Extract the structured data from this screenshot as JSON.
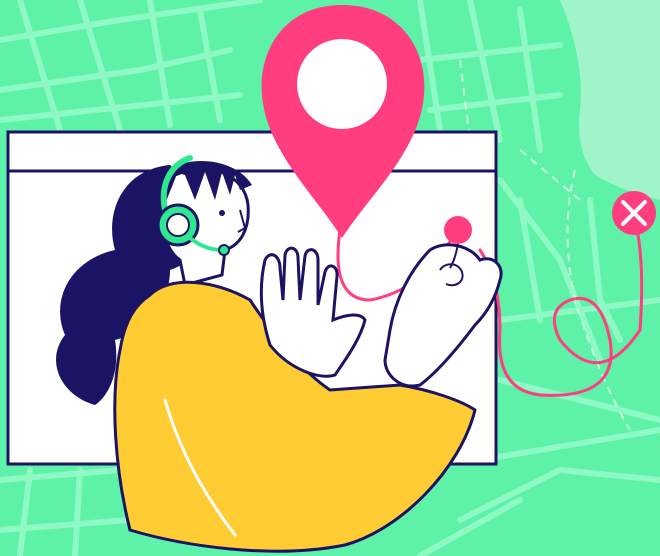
{
  "colors": {
    "map_background": "#5ef2a8",
    "map_roads": "#8ff9c6",
    "map_park": "#9ff5c9",
    "outline": "#1b1464",
    "window_fill": "#ffffff",
    "pin": "#ff3d7f",
    "sweater": "#ffcc33",
    "headset": "#2ee88f",
    "hair": "#1b1464"
  },
  "icons": {
    "pin": "map-pin-icon",
    "destination": "close-x-icon",
    "headset": "headset-icon"
  }
}
